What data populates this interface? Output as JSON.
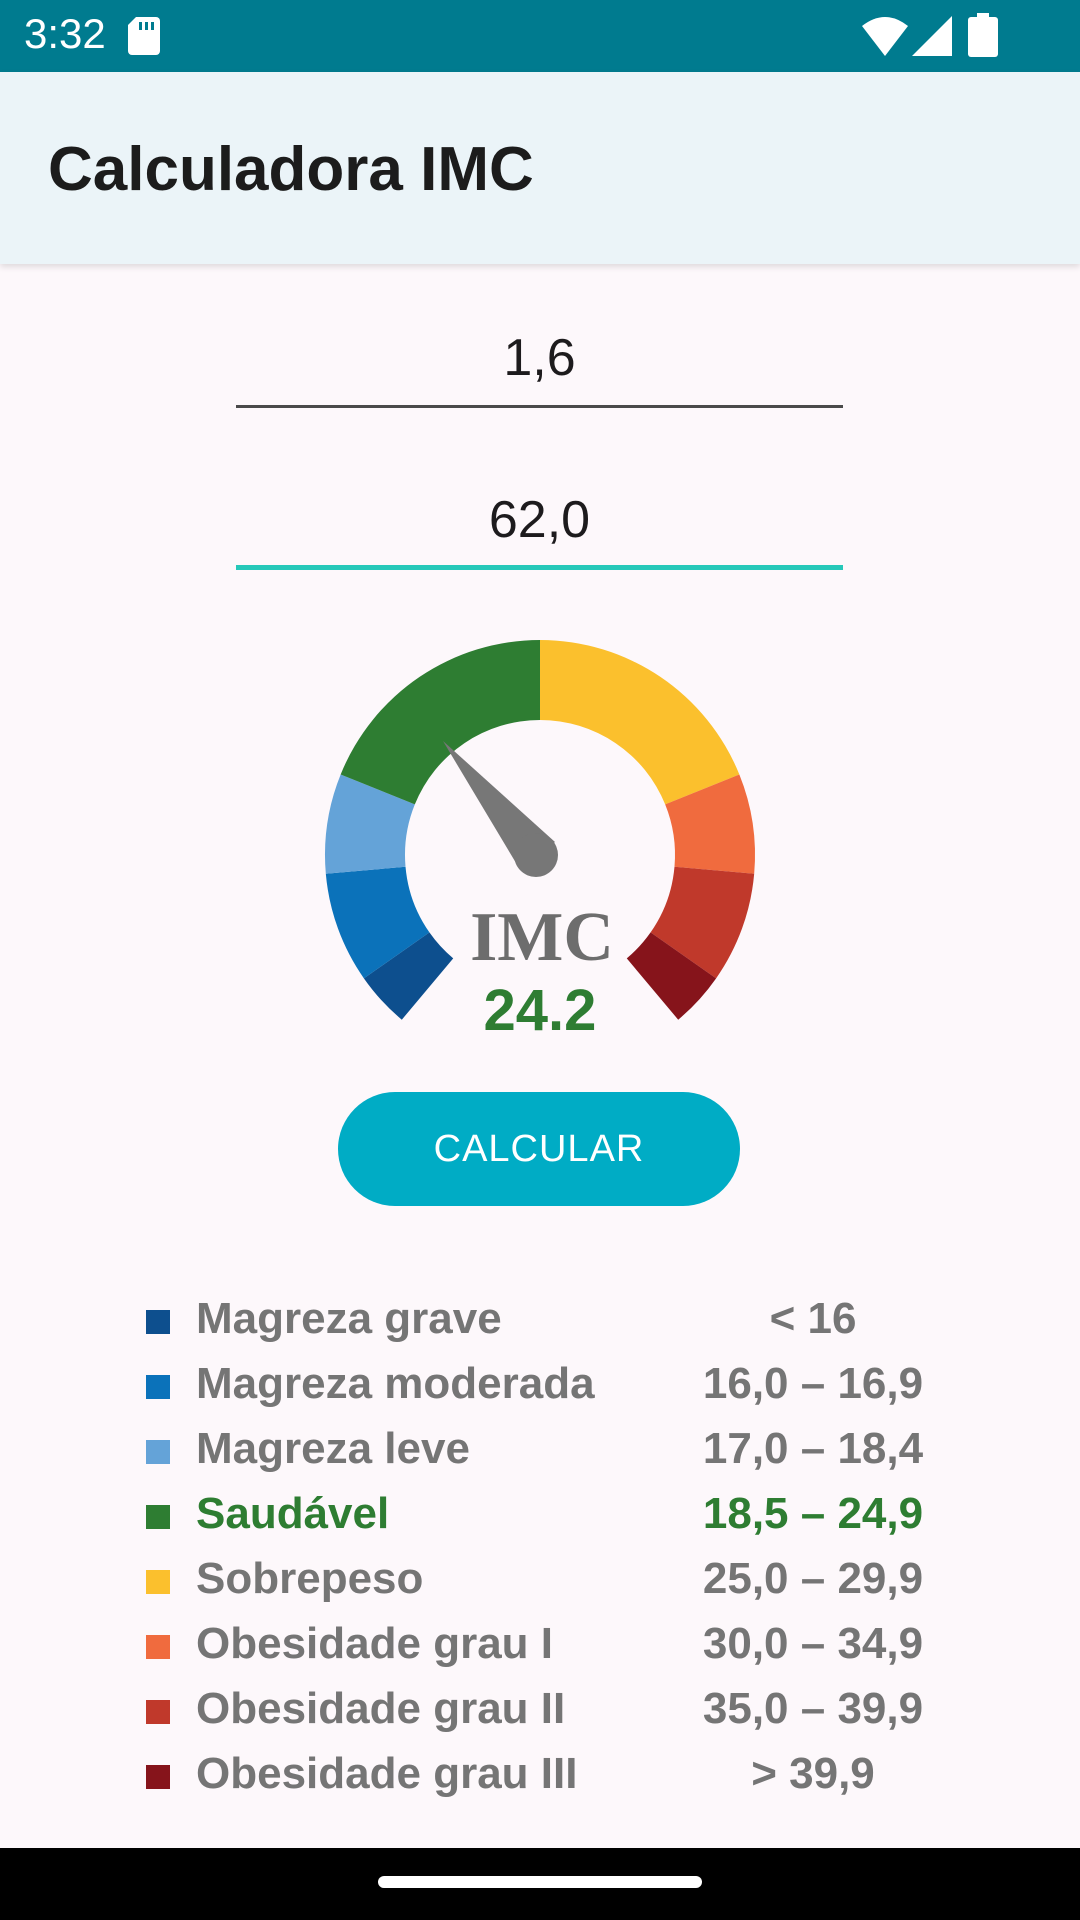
{
  "status_bar": {
    "time": "3:32"
  },
  "app_bar": {
    "title": "Calculadora IMC"
  },
  "inputs": {
    "height_value": "1,6",
    "weight_value": "62,0"
  },
  "gauge": {
    "label": "IMC",
    "value": "24.2",
    "value_color": "#2e7d32",
    "needle_color": "#777777"
  },
  "button": {
    "label": "CALCULAR",
    "color": "#00acc5"
  },
  "legend": [
    {
      "label": "Magreza grave",
      "range": "< 16",
      "color": "#0d4f8e",
      "active": false
    },
    {
      "label": "Magreza moderada",
      "range": "16,0 – 16,9",
      "color": "#0b72ba",
      "active": false
    },
    {
      "label": "Magreza leve",
      "range": "17,0 – 18,4",
      "color": "#64a3d8",
      "active": false
    },
    {
      "label": "Saudável",
      "range": "18,5 – 24,9",
      "color": "#2e7d32",
      "active": true
    },
    {
      "label": "Sobrepeso",
      "range": "25,0 – 29,9",
      "color": "#fbc02d",
      "active": false
    },
    {
      "label": "Obesidade grau I",
      "range": "30,0 – 34,9",
      "color": "#f06b3e",
      "active": false
    },
    {
      "label": "Obesidade grau II",
      "range": "35,0 – 39,9",
      "color": "#c0392b",
      "active": false
    },
    {
      "label": "Obesidade grau III",
      "range": "> 39,9",
      "color": "#86141b",
      "active": false
    }
  ]
}
